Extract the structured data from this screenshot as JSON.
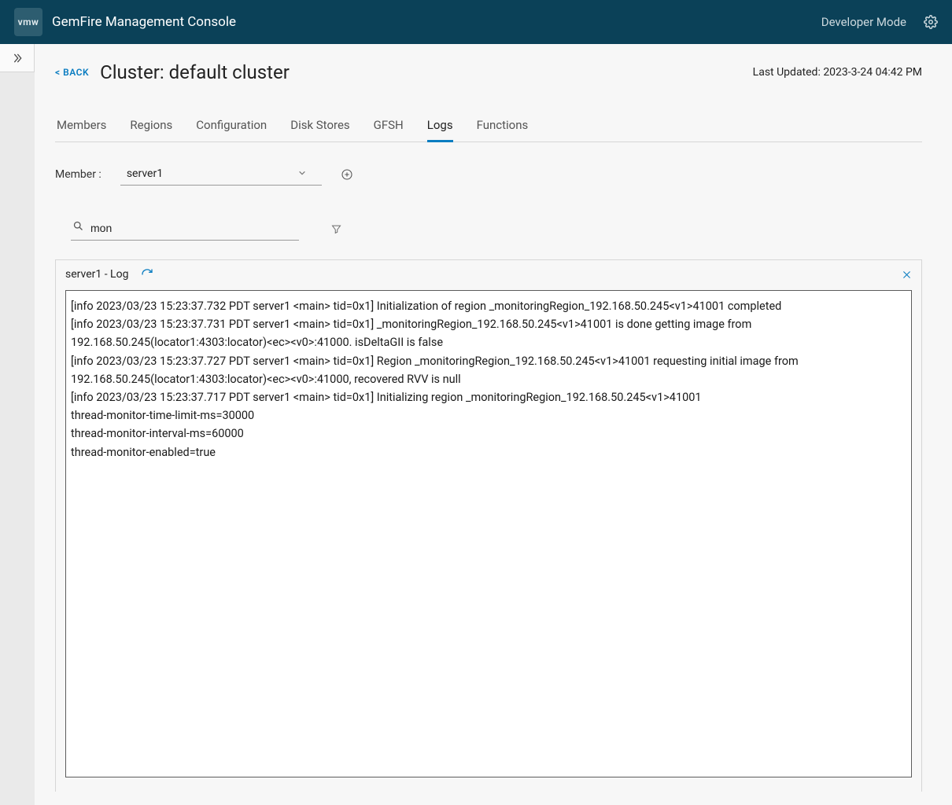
{
  "topbar": {
    "brand_short": "vmw",
    "app_title": "GemFire Management Console",
    "dev_mode_label": "Developer Mode"
  },
  "header": {
    "back_label": "< BACK",
    "title": "Cluster: default cluster",
    "last_updated_label": "Last Updated: 2023-3-24 04:42 PM"
  },
  "tabs": [
    {
      "id": "members",
      "label": "Members",
      "active": false
    },
    {
      "id": "regions",
      "label": "Regions",
      "active": false
    },
    {
      "id": "configuration",
      "label": "Configuration",
      "active": false
    },
    {
      "id": "diskstores",
      "label": "Disk Stores",
      "active": false
    },
    {
      "id": "gfsh",
      "label": "GFSH",
      "active": false
    },
    {
      "id": "logs",
      "label": "Logs",
      "active": true
    },
    {
      "id": "functions",
      "label": "Functions",
      "active": false
    }
  ],
  "member": {
    "label": "Member :",
    "selected": "server1"
  },
  "search": {
    "value": "mon"
  },
  "icons": {
    "expand": "expand-icon",
    "gear": "gear-icon",
    "chevron": "chevron-down-icon",
    "add": "add-circle-icon",
    "search": "search-icon",
    "filter": "filter-icon",
    "refresh": "refresh-icon",
    "close": "close-icon"
  },
  "log_panel": {
    "title": "server1 - Log",
    "lines": [
      "[info 2023/03/23 15:23:37.732 PDT server1 <main> tid=0x1] Initialization of region _monitoringRegion_192.168.50.245<v1>41001 completed",
      "[info 2023/03/23 15:23:37.731 PDT server1 <main> tid=0x1] _monitoringRegion_192.168.50.245<v1>41001 is done getting image from 192.168.50.245(locator1:4303:locator)<ec><v0>:41000. isDeltaGII is false",
      "[info 2023/03/23 15:23:37.727 PDT server1 <main> tid=0x1] Region _monitoringRegion_192.168.50.245<v1>41001 requesting initial image from 192.168.50.245(locator1:4303:locator)<ec><v0>:41000, recovered RVV is null",
      "[info 2023/03/23 15:23:37.717 PDT server1 <main> tid=0x1] Initializing region _monitoringRegion_192.168.50.245<v1>41001",
      "thread-monitor-time-limit-ms=30000",
      "thread-monitor-interval-ms=60000",
      "thread-monitor-enabled=true"
    ]
  }
}
